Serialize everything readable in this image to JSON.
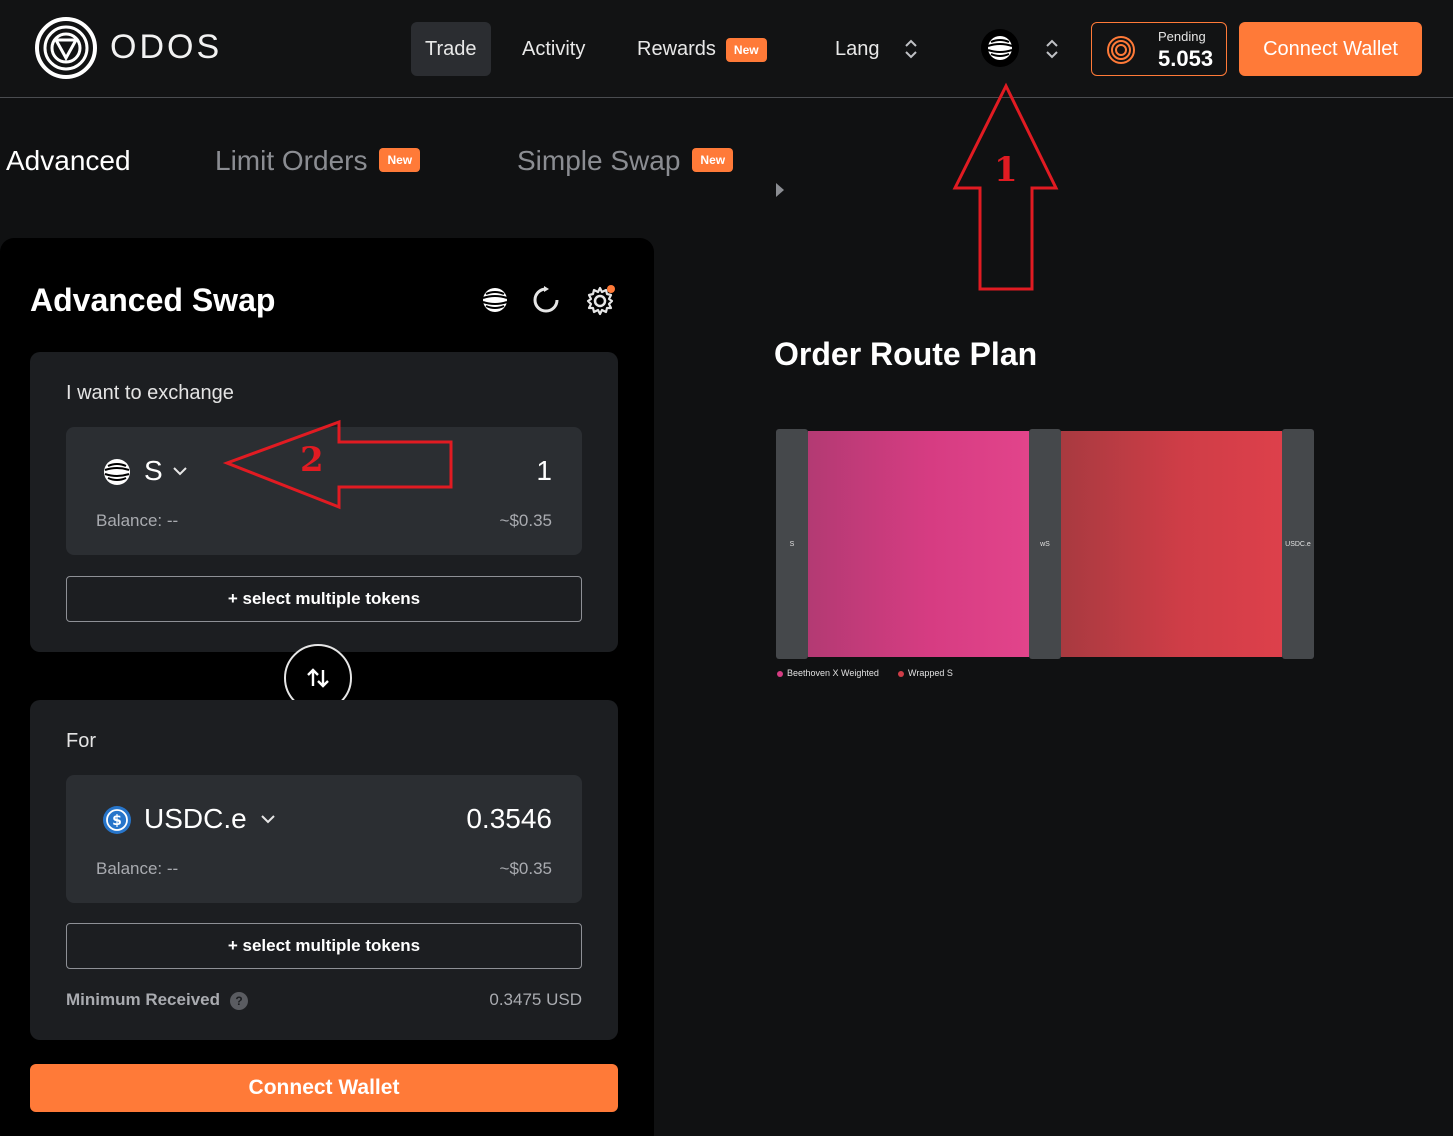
{
  "header": {
    "logo_text": "ODOS",
    "nav": {
      "trade": "Trade",
      "activity": "Activity",
      "rewards": "Rewards",
      "rewards_badge": "New",
      "lang": "Lang"
    },
    "pending_label": "Pending",
    "pending_value": "5.053",
    "connect_wallet": "Connect Wallet"
  },
  "tabs": {
    "advanced": "Advanced",
    "limit_orders": "Limit Orders",
    "limit_badge": "New",
    "simple_swap": "Simple Swap",
    "simple_badge": "New"
  },
  "swap": {
    "title": "Advanced Swap",
    "from": {
      "label": "I want to exchange",
      "token": "S",
      "amount": "1",
      "balance": "Balance: --",
      "usd": "~$0.35",
      "multi": "+ select multiple tokens"
    },
    "to": {
      "label": "For",
      "token": "USDC.e",
      "amount": "0.3546",
      "balance": "Balance: --",
      "usd": "~$0.35",
      "multi": "+ select multiple tokens",
      "min_label": "Minimum Received",
      "min_help": "?",
      "min_value": "0.3475 USD"
    },
    "connect_wallet": "Connect Wallet"
  },
  "route": {
    "title": "Order Route Plan",
    "nodes": [
      "S",
      "wS",
      "USDC.e"
    ],
    "legend": [
      {
        "label": "Beethoven X Weighted",
        "color": "#d63c82"
      },
      {
        "label": "Wrapped S",
        "color": "#cf3d47"
      }
    ]
  },
  "annotations": {
    "arrow1": "1",
    "arrow2": "2",
    "color": "#e11b22"
  },
  "colors": {
    "accent": "#ff7a38",
    "background": "#101112",
    "card": "#1c1e21"
  }
}
